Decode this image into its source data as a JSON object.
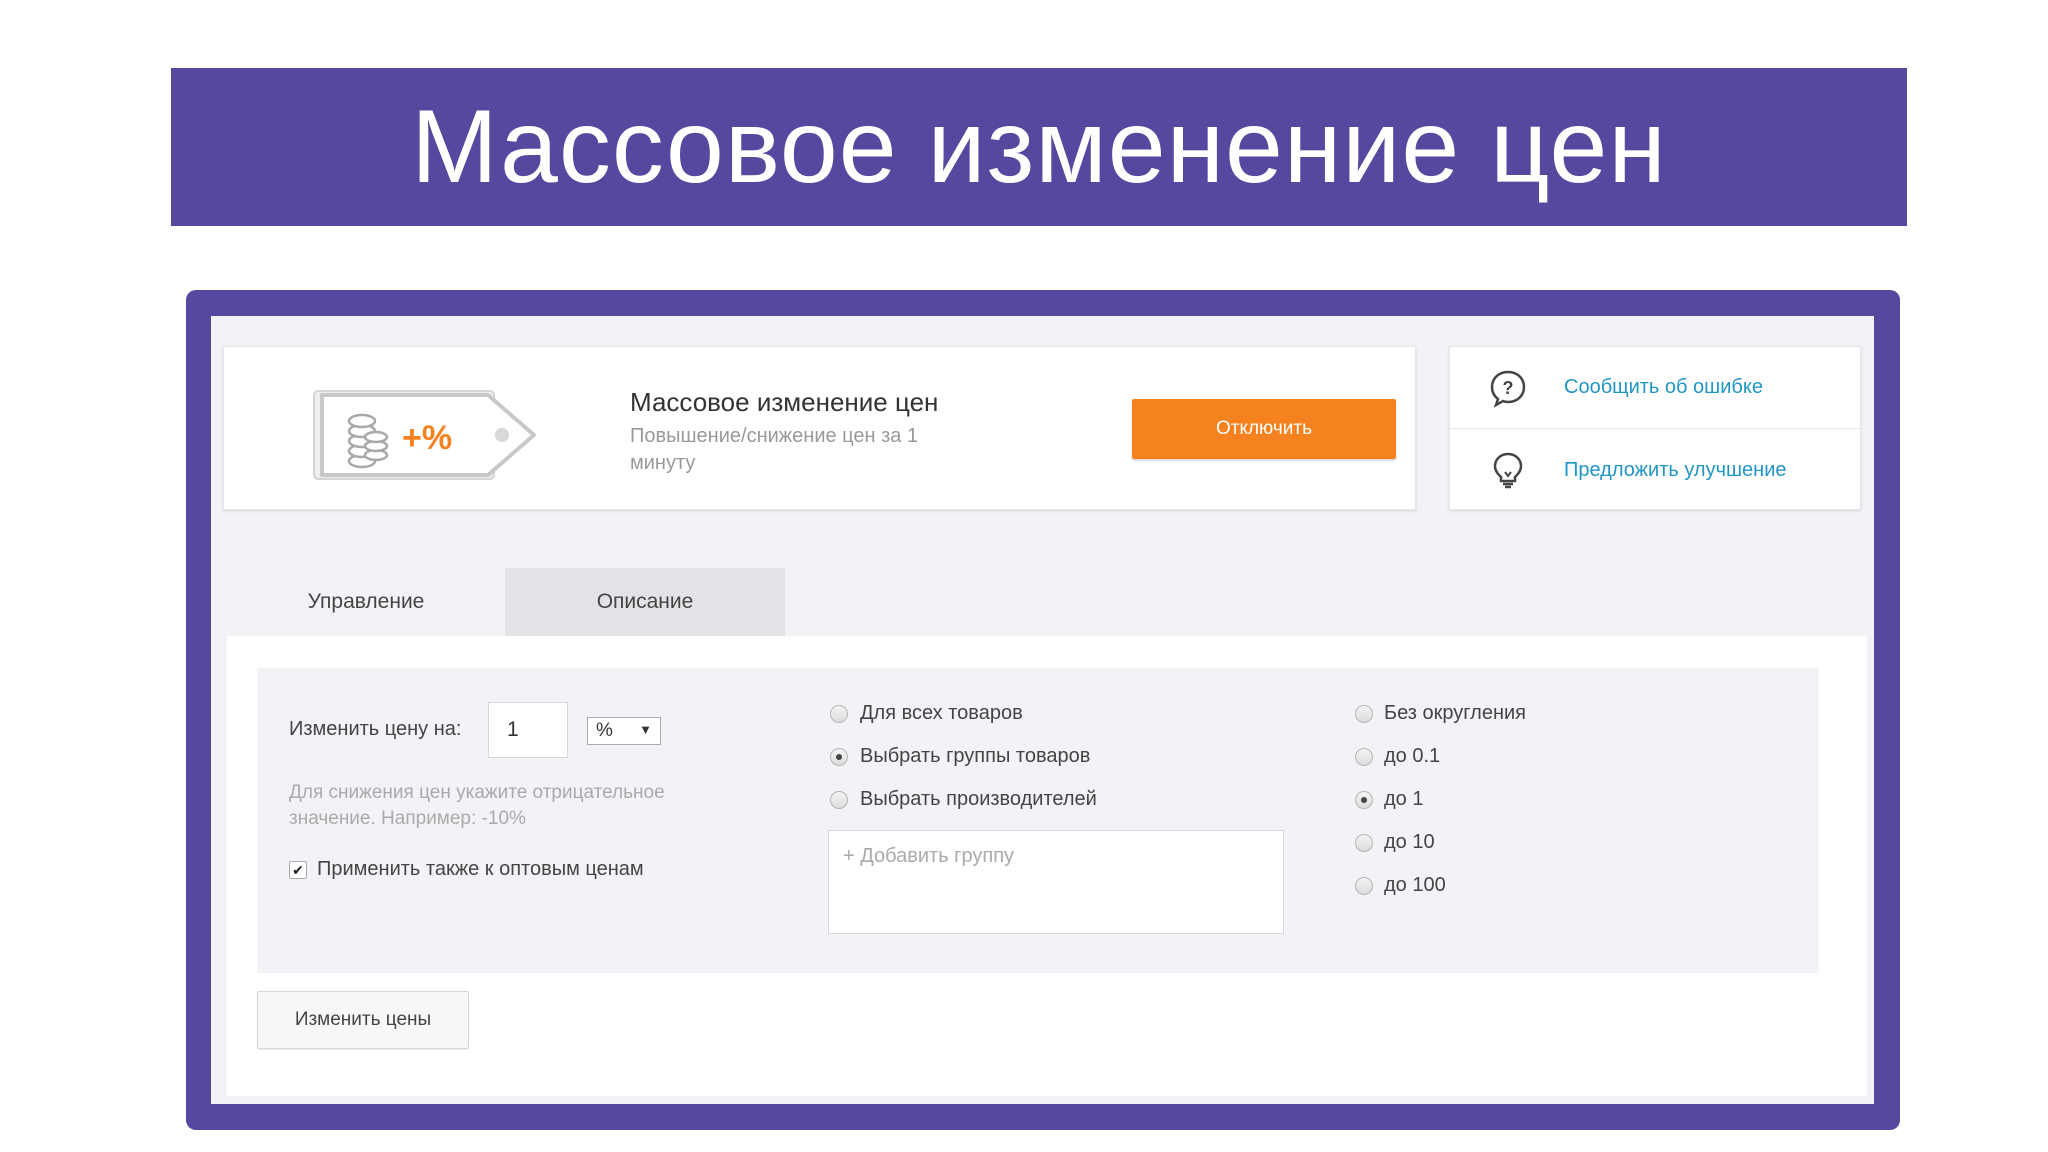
{
  "slide": {
    "title": "Массовое изменение цен"
  },
  "app": {
    "logo_text": "+%",
    "title": "Массовое изменение цен",
    "subtitle": "Повышение/снижение цен за 1 минуту",
    "disable_button": "Отключить",
    "accent_color": "#f5821f",
    "frame_color": "#54489f"
  },
  "help": {
    "report_error": "Сообщить об ошибке",
    "suggest_improvement": "Предложить улучшение"
  },
  "tabs": [
    {
      "label": "Управление",
      "active": true
    },
    {
      "label": "Описание",
      "active": false
    }
  ],
  "form": {
    "change_price_label": "Изменить цену на:",
    "change_price_value": "1",
    "unit_value": "%",
    "hint": "Для снижения цен укажите отрицательное значение. Например: -10%",
    "wholesale_label": "Применить также к оптовым ценам",
    "wholesale_checked": true,
    "scope_options": [
      {
        "label": "Для всех товаров",
        "checked": false
      },
      {
        "label": "Выбрать группы товаров",
        "checked": true
      },
      {
        "label": "Выбрать производителей",
        "checked": false
      }
    ],
    "add_group_placeholder": "+ Добавить группу",
    "rounding_options": [
      {
        "label": "Без округления",
        "checked": false
      },
      {
        "label": "до 0.1",
        "checked": false
      },
      {
        "label": "до 1",
        "checked": true
      },
      {
        "label": "до 10",
        "checked": false
      },
      {
        "label": "до 100",
        "checked": false
      }
    ],
    "submit_button": "Изменить цены"
  }
}
